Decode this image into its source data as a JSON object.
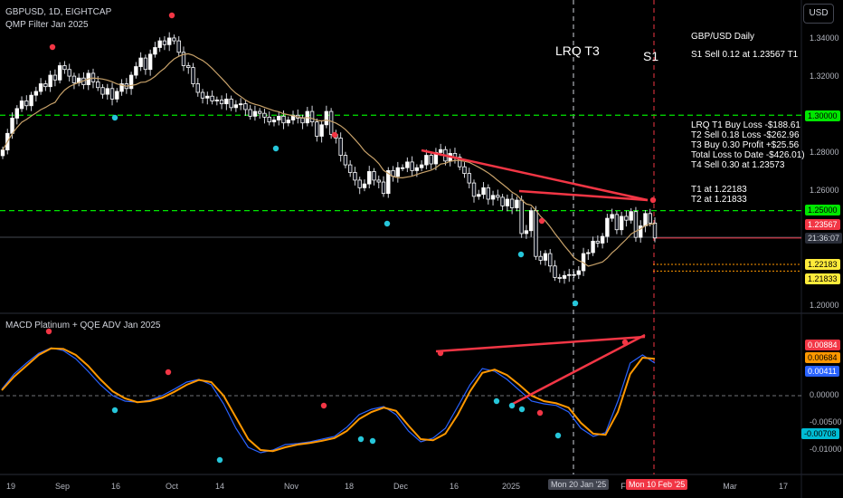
{
  "header": {
    "line1": "GBPUSD, 1D, EIGHTCAP",
    "line2": "QMP Filter Jan 2025",
    "macd_title": "MACD Platinum + QQE ADV Jan 2025",
    "currency_button": "USD"
  },
  "annotations": {
    "lrq_t3": "LRQ T3",
    "s1": "S1",
    "info_title": "GBP/USD Daily",
    "info_s1": "S1 Sell 0.12 at 1.23567 T1",
    "trades": [
      "LRQ T1 Buy Loss -$188.61",
      "T2 Sell 0.18 Loss -$262.96",
      "T3 Buy 0.30 Profit +$25.56",
      "Total Loss to Date -$426.01)",
      "T4 Sell 0.30 at 1.23573"
    ],
    "targets": [
      "T1 at 1.22183",
      "T2 at 1.21833"
    ]
  },
  "price_axis": {
    "ticks": [
      "1.34000",
      "1.32000",
      "1.28000",
      "1.26000",
      "1.20000"
    ],
    "badges": [
      {
        "text": "1.30000",
        "bg": "#00e600",
        "fg": "#000000",
        "value": 1.3
      },
      {
        "text": "1.25000",
        "bg": "#00e600",
        "fg": "#000000",
        "value": 1.25
      },
      {
        "text": "1.23567",
        "bg": "#f23645",
        "fg": "#ffffff",
        "value": 1.23567
      },
      {
        "text": "21:36:07",
        "bg": "#2a2e39",
        "fg": "#d1d4dc",
        "value": 1.232
      },
      {
        "text": "1.22183",
        "bg": "#ffeb3b",
        "fg": "#000000",
        "value": 1.22183
      },
      {
        "text": "1.21833",
        "bg": "#ffeb3b",
        "fg": "#000000",
        "value": 1.21833
      }
    ]
  },
  "macd_axis": {
    "ticks": [
      "0.00000",
      "-0.00500",
      "-0.01000"
    ],
    "badges": [
      {
        "text": "0.00884",
        "bg": "#f23645",
        "fg": "#ffffff",
        "value": 0.00884
      },
      {
        "text": "0.00684",
        "bg": "#ff9800",
        "fg": "#000000",
        "value": 0.00684
      },
      {
        "text": "0.00411",
        "bg": "#2962ff",
        "fg": "#ffffff",
        "value": 0.00411
      },
      {
        "text": "-0.00708",
        "bg": "#00bcd4",
        "fg": "#000000",
        "value": -0.00708
      }
    ]
  },
  "time_axis": {
    "labels": [
      "19",
      "Sep",
      "16",
      "Oct",
      "14",
      "Nov",
      "18",
      "Dec",
      "16",
      "2025",
      "F",
      "Mar",
      "17"
    ],
    "crosshair_labels": [
      "Mon 20 Jan '25",
      "Mon 10 Feb '25"
    ],
    "cut_label": "7"
  },
  "colors": {
    "bull": "#ffffff",
    "bear": "#ffffff",
    "ma": "#c8a26a",
    "green_line": "#00e600",
    "red": "#f23645",
    "orange": "#ff9800",
    "blue": "#2962ff",
    "cyan": "#26c6da",
    "yellow": "#ffeb3b"
  },
  "chart_data": {
    "type": "candlestick",
    "symbol": "GBPUSD",
    "timeframe": "1D",
    "price_range": [
      1.195,
      1.352
    ],
    "closes": [
      1.2818,
      1.2905,
      1.2985,
      1.3035,
      1.3075,
      1.305,
      1.3105,
      1.3125,
      1.3165,
      1.315,
      1.321,
      1.3185,
      1.326,
      1.324,
      1.3205,
      1.317,
      1.3195,
      1.316,
      1.322,
      1.3175,
      1.3145,
      1.311,
      1.314,
      1.3085,
      1.3125,
      1.3165,
      1.314,
      1.321,
      1.3255,
      1.33,
      1.324,
      1.332,
      1.3355,
      1.339,
      1.337,
      1.3405,
      1.339,
      1.333,
      1.326,
      1.325,
      1.3165,
      1.312,
      1.309,
      1.31,
      1.3075,
      1.308,
      1.306,
      1.3085,
      1.304,
      1.3055,
      1.306,
      1.303,
      1.2995,
      1.302,
      1.301,
      1.299,
      1.2965,
      1.2975,
      1.2995,
      1.296,
      1.2975,
      1.3,
      1.2985,
      1.296,
      1.302,
      1.2965,
      1.289,
      1.295,
      1.302,
      1.29,
      1.288,
      1.279,
      1.274,
      1.27,
      1.266,
      1.262,
      1.264,
      1.2705,
      1.266,
      1.265,
      1.259,
      1.271,
      1.268,
      1.2725,
      1.2725,
      1.2755,
      1.271,
      1.2725,
      1.274,
      1.279,
      1.2745,
      1.2805,
      1.282,
      1.276,
      1.28,
      1.278,
      1.273,
      1.2695,
      1.2645,
      1.2575,
      1.2585,
      1.262,
      1.256,
      1.258,
      1.257,
      1.2525,
      1.256,
      1.2515,
      1.2555,
      1.238,
      1.2395,
      1.25,
      1.226,
      1.224,
      1.2275,
      1.221,
      1.215,
      1.2145,
      1.216,
      1.2165,
      1.2165,
      1.2185,
      1.2275,
      1.228,
      1.234,
      1.233,
      1.2365,
      1.246,
      1.248,
      1.24,
      1.247,
      1.245,
      1.2495,
      1.236,
      1.242,
      1.2485,
      1.2435,
      1.2357
    ],
    "ma_type": "moving average (tan)",
    "horizontal_levels": {
      "green_dashed": [
        1.3,
        1.25
      ],
      "current_price": 1.23567,
      "targets": [
        1.22183,
        1.21833
      ]
    },
    "trendlines_price": [
      {
        "from": [
          1.282,
          "early Dec"
        ],
        "to": [
          1.2545,
          "10 Feb '25"
        ]
      }
    ],
    "macd": {
      "range": [
        -0.0115,
        0.0107
      ],
      "macd_line": [
        0.0012,
        0.004,
        0.006,
        0.0078,
        0.0088,
        0.0083,
        0.0068,
        0.0045,
        0.002,
        0.0,
        -0.001,
        -0.0012,
        -0.0008,
        0.0,
        0.0012,
        0.0025,
        0.003,
        0.002,
        -0.0015,
        -0.006,
        -0.0095,
        -0.0105,
        -0.01,
        -0.009,
        -0.0088,
        -0.0085,
        -0.008,
        -0.0075,
        -0.0058,
        -0.0035,
        -0.0025,
        -0.002,
        -0.0035,
        -0.0065,
        -0.0085,
        -0.0078,
        -0.006,
        -0.002,
        0.002,
        0.005,
        0.0045,
        0.003,
        0.001,
        -0.001,
        -0.0015,
        -0.0018,
        -0.003,
        -0.006,
        -0.0075,
        -0.0068,
        -0.001,
        0.006,
        0.0075,
        0.006
      ],
      "signal_line": [
        0.001,
        0.0035,
        0.0055,
        0.0075,
        0.0087,
        0.0086,
        0.0075,
        0.0055,
        0.003,
        0.0008,
        -0.0005,
        -0.0012,
        -0.001,
        -0.0004,
        0.0007,
        0.002,
        0.0029,
        0.0025,
        0.0,
        -0.004,
        -0.008,
        -0.01,
        -0.0102,
        -0.0095,
        -0.009,
        -0.0087,
        -0.0083,
        -0.0078,
        -0.0065,
        -0.0043,
        -0.003,
        -0.0022,
        -0.0028,
        -0.0055,
        -0.008,
        -0.0082,
        -0.007,
        -0.0035,
        0.0008,
        0.0042,
        0.0048,
        0.0038,
        0.002,
        0.0,
        -0.001,
        -0.0014,
        -0.0022,
        -0.005,
        -0.007,
        -0.0072,
        -0.003,
        0.004,
        0.007,
        0.0068
      ],
      "current": {
        "macd": 0.00411,
        "signal": 0.00684,
        "qqe": 0.00884,
        "other": -0.00708
      }
    }
  }
}
